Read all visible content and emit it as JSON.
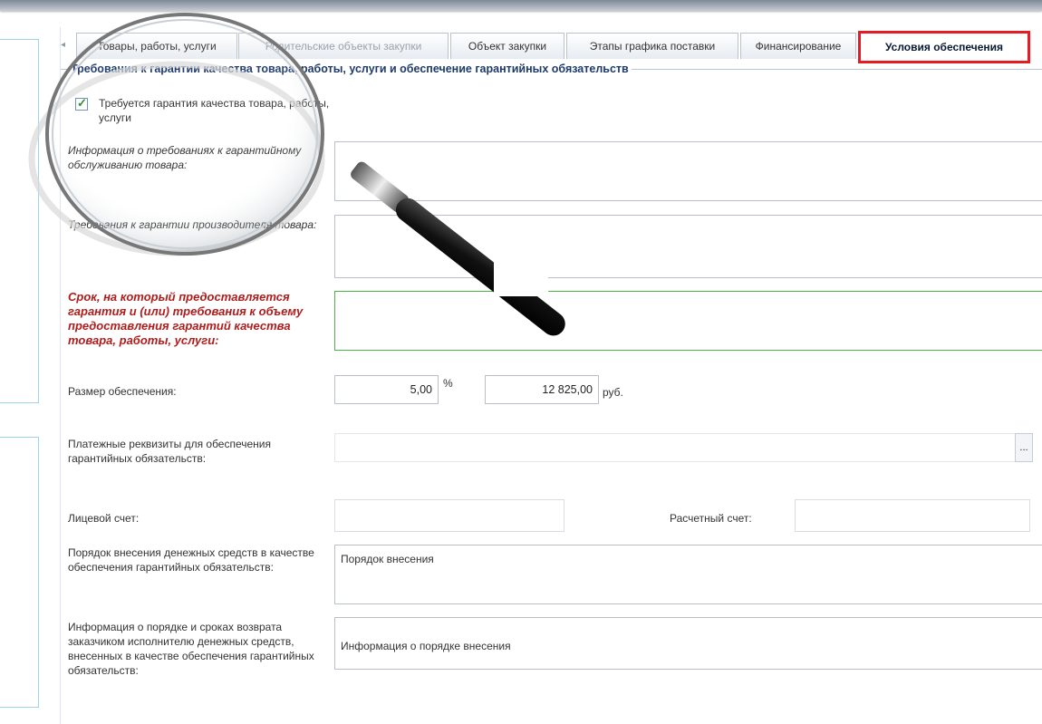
{
  "tabs": [
    {
      "label": "Товары, работы, услуги",
      "dim": false
    },
    {
      "label": "Родительские объекты закупки",
      "dim": true
    },
    {
      "label": "Объект закупки",
      "dim": false
    },
    {
      "label": "Этапы графика поставки",
      "dim": false
    },
    {
      "label": "Финансирование",
      "dim": false
    },
    {
      "label": "Условия обеспечения",
      "active": true
    }
  ],
  "section": {
    "title": "Требования к гарантии качества товара, работы, услуги и обеспечение гарантийных обязательств"
  },
  "form": {
    "guarantee_required": {
      "label": "Требуется гарантия качества товара, работы, услуги",
      "checked": true
    },
    "warranty_service_info": {
      "label": "Информация о требованиях к гарантийному обслуживанию товара:",
      "value": ""
    },
    "manufacturer_guarantee": {
      "label": "Требования к гарантии производителя товара:",
      "value": ""
    },
    "guarantee_term": {
      "label": "Срок, на который предоставляется гарантия и (или) требования к объему предоставления гарантий качества товара, работы, услуги:",
      "value": ""
    },
    "security_size": {
      "label": "Размер обеспечения:",
      "percent": "5,00",
      "percent_unit": "%",
      "amount": "12 825,00",
      "amount_unit": "руб."
    },
    "payment_details": {
      "label": "Платежные реквизиты для обеспечения гарантийных обязательств:",
      "button": "..."
    },
    "personal_account": {
      "label": "Лицевой счет:",
      "value": ""
    },
    "settlement_account": {
      "label": "Расчетный счет:",
      "value": ""
    },
    "deposit_order": {
      "label": "Порядок внесения денежных средств в качестве обеспечения гарантийных обязательств:",
      "value": "Порядок внесения"
    },
    "return_info": {
      "label": "Информация о порядке и сроках возврата заказчиком исполнителю денежных средств, внесенных в качестве обеспечения гарантийных обязательств:",
      "value": "Информация о порядке внесения"
    }
  },
  "colors": {
    "active_tab_border": "#e51c23",
    "required_label": "#b01c1c",
    "valid_field_border": "#4bb543"
  }
}
